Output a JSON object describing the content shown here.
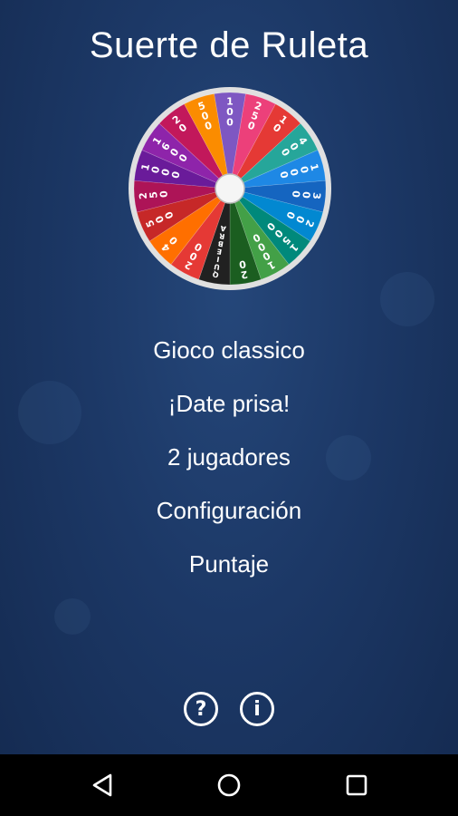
{
  "app": {
    "title": "Suerte de Ruleta"
  },
  "wheel": {
    "segments": [
      {
        "label": "100",
        "color": "#7e57c2"
      },
      {
        "label": "250",
        "color": "#ec407a"
      },
      {
        "label": "10",
        "color": "#e53935"
      },
      {
        "label": "400",
        "color": "#26a69a"
      },
      {
        "label": "1000",
        "color": "#1e88e5"
      },
      {
        "label": "300",
        "color": "#1565c0"
      },
      {
        "label": "200",
        "color": "#0288d1"
      },
      {
        "label": "1500",
        "color": "#00897b"
      },
      {
        "label": "1000",
        "color": "#43a047"
      },
      {
        "label": "20",
        "color": "#1b5e20"
      },
      {
        "label": "QUIEBRA",
        "color": "#212121"
      },
      {
        "label": "200",
        "color": "#e53935"
      },
      {
        "label": "40",
        "color": "#ff6f00"
      },
      {
        "label": "500",
        "color": "#c62828"
      },
      {
        "label": "250",
        "color": "#ad1457"
      },
      {
        "label": "1000",
        "color": "#6a1b9a"
      },
      {
        "label": "1600",
        "color": "#8e24aa"
      },
      {
        "label": "20",
        "color": "#c2185b"
      },
      {
        "label": "500",
        "color": "#fb8c00"
      }
    ],
    "rim_color": "#e0e0e0",
    "hub_color": "#f5f5f5"
  },
  "menu": {
    "items": [
      {
        "label": "Gioco classico"
      },
      {
        "label": "¡Date prisa!"
      },
      {
        "label": "2 jugadores"
      },
      {
        "label": "Configuración"
      },
      {
        "label": "Puntaje"
      }
    ]
  },
  "footer": {
    "help_icon": "?",
    "info_icon": "i"
  },
  "navbar": {
    "back": "back-icon",
    "home": "home-icon",
    "recents": "recents-icon"
  }
}
